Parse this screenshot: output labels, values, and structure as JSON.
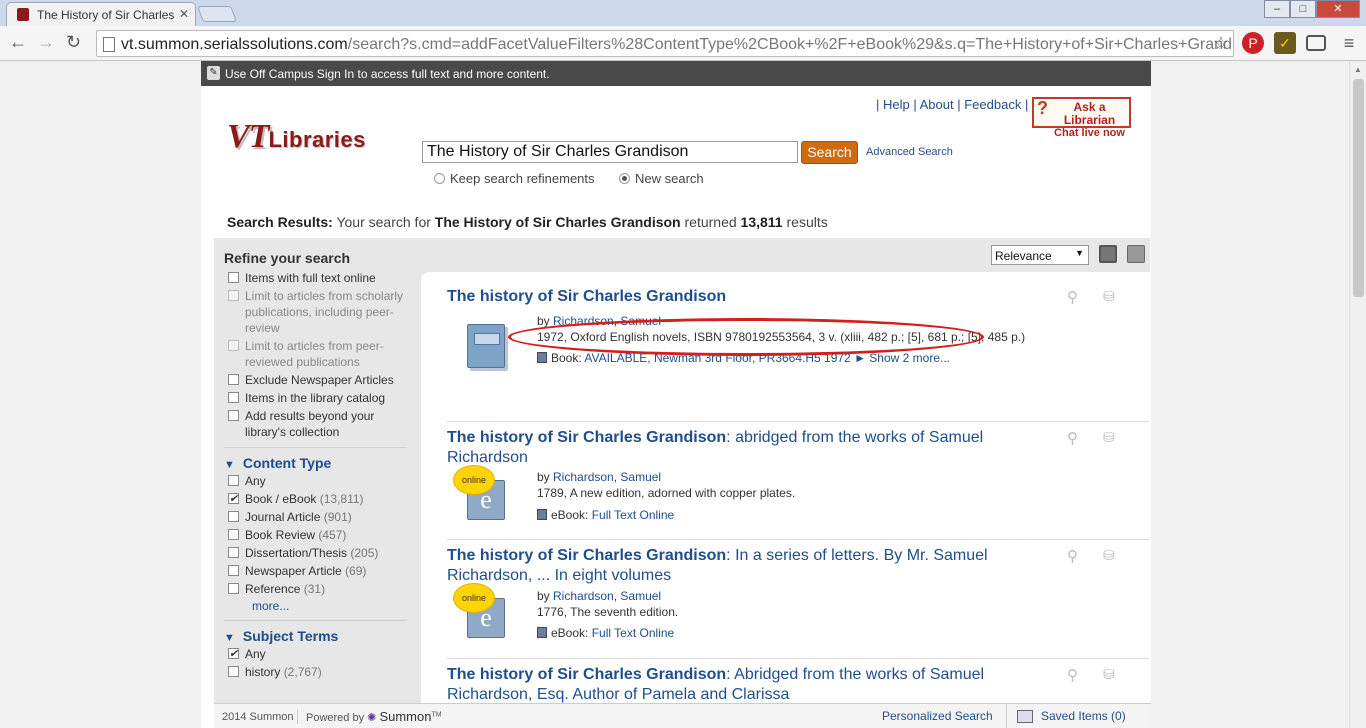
{
  "browser": {
    "tab_title": "The History of Sir Charles",
    "url_domain": "vt.summon.serialssolutions.com",
    "url_path": "/search?s.cmd=addFacetValueFilters%28ContentType%2CBook+%2F+eBook%29&s.q=The+History+of+Sir+Charles+Grandi",
    "nav": {
      "back": "←",
      "forward": "→",
      "reload": "↻"
    },
    "window_buttons": {
      "minimize": "–",
      "maximize": "□",
      "close": "✕"
    }
  },
  "offcampus": {
    "text": "Use Off Campus Sign In to access full text and more content."
  },
  "header": {
    "links": [
      "Help",
      "About",
      "Feedback"
    ],
    "ask_line1": "Ask a Librarian",
    "ask_line2": "Chat live now",
    "logo_vt": "VT",
    "logo_lib": "Libraries"
  },
  "search": {
    "query": "The History of Sir Charles Grandison",
    "button": "Search",
    "advanced": "Advanced Search",
    "opt_keep": "Keep search refinements",
    "opt_new": "New search"
  },
  "summary": {
    "label": "Search Results:",
    "pre": " Your search for ",
    "query": "The History of Sir Charles Grandison",
    "mid": " returned ",
    "count": "13,811",
    "post": " results"
  },
  "sort": {
    "selected": "Relevance"
  },
  "refine": {
    "title": "Refine your search",
    "filters": [
      "Items with full text online",
      "Limit to articles from scholarly publications, including peer-review",
      "Limit to articles from peer-reviewed publications",
      "Exclude Newspaper Articles",
      "Items in the library catalog",
      "Add results beyond your library's collection"
    ],
    "content_type": {
      "title": "Content Type",
      "any": "Any",
      "items": [
        {
          "label": "Book / eBook",
          "count": "(13,811)"
        },
        {
          "label": "Journal Article",
          "count": "(901)"
        },
        {
          "label": "Book Review",
          "count": "(457)"
        },
        {
          "label": "Dissertation/Thesis",
          "count": "(205)"
        },
        {
          "label": "Newspaper Article",
          "count": "(69)"
        },
        {
          "label": "Reference",
          "count": "(31)"
        }
      ],
      "more": "more..."
    },
    "subject_terms": {
      "title": "Subject Terms",
      "any": "Any",
      "items": [
        {
          "label": "history",
          "count": "(2,767)"
        }
      ]
    }
  },
  "results": [
    {
      "title_bold": "The history of Sir Charles Grandison",
      "title_rest": "",
      "by": "by ",
      "author_last": "Richardson",
      "author_first": "Samuel",
      "meta": "1972, Oxford English novels, ISBN 9780192553564, 3 v. (xliii, 482 p.; [5], 681 p.; [5], 485 p.)",
      "avail_type": "Book:",
      "avail_link": "AVAILABLE, Newman 3rd Floor, PR3664.H5 1972",
      "show_more": "► Show 2 more..."
    },
    {
      "title_bold": "The history of Sir Charles Grandison",
      "title_rest": ": abridged from the works of Samuel Richardson",
      "by": "by ",
      "author_last": "Richardson",
      "author_first": "Samuel",
      "meta": "1789, A new edition, adorned with copper plates.",
      "avail_type": "eBook:",
      "avail_link": "Full Text Online",
      "badge": "online"
    },
    {
      "title_bold": "The history of Sir Charles Grandison",
      "title_rest": ": In a series of letters. By Mr. Samuel Richardson, ... In eight volumes",
      "by": "by ",
      "author_last": "Richardson",
      "author_first": "Samuel",
      "meta": "1776, The seventh edition.",
      "avail_type": "eBook:",
      "avail_link": "Full Text Online",
      "badge": "online"
    },
    {
      "title_bold": "The history of Sir Charles Grandison",
      "title_rest": ": Abridged from the works of Samuel Richardson, Esq. Author of Pamela and Clarissa"
    }
  ],
  "footer": {
    "copyright": "2014 Summon",
    "powered": "Powered by",
    "brand": "Summon",
    "tm": "TM",
    "personalized": "Personalized Search",
    "saved": "Saved Items (0)"
  },
  "colors": {
    "accent": "#1f4e8c",
    "search_button": "#d06a10",
    "annotation": "#d41f1f",
    "logo": "#8b1a1a"
  }
}
